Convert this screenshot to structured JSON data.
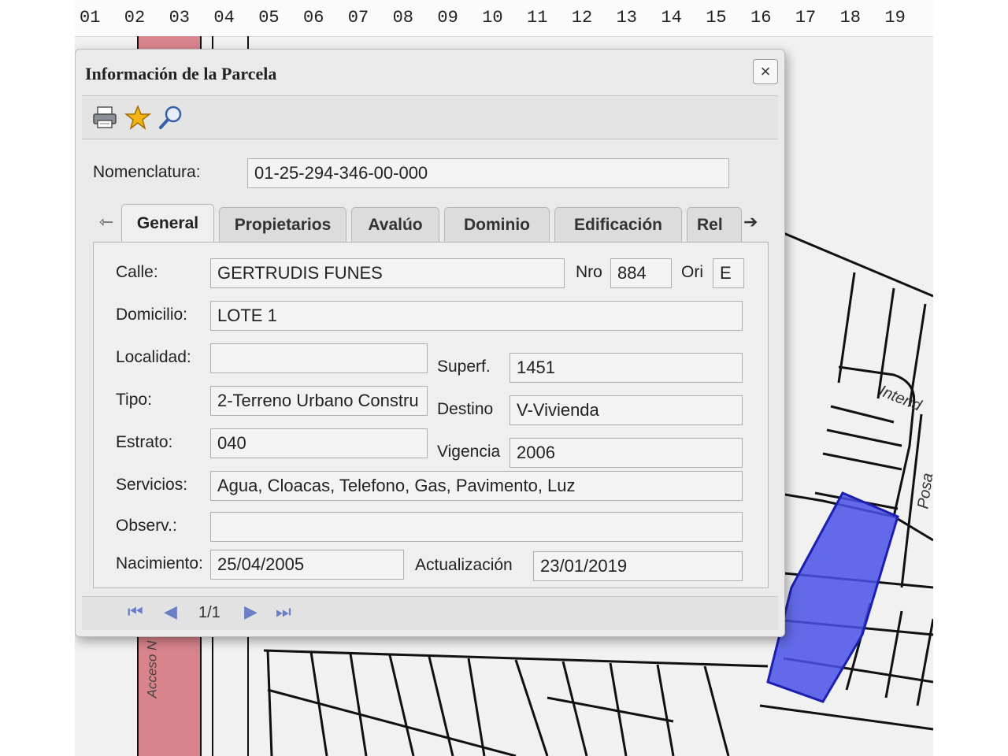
{
  "ruler": {
    "numbers": [
      "01",
      "02",
      "03",
      "04",
      "05",
      "06",
      "07",
      "08",
      "09",
      "10",
      "11",
      "12",
      "13",
      "14",
      "15",
      "16",
      "17",
      "18",
      "19"
    ]
  },
  "map": {
    "street_labels": {
      "intendente": "Intend",
      "posadas": "Posa",
      "acceso": "Acceso N"
    }
  },
  "dialog": {
    "title": "Información de la Parcela",
    "close_icon": "×",
    "toolbar": {
      "icons": [
        "print-icon",
        "star-icon",
        "search-icon"
      ]
    },
    "nomenclatura_label": "Nomenclatura:",
    "nomenclatura_value": "01-25-294-346-00-000",
    "tabs": {
      "prev_arrow": "⇽",
      "next_arrow": "➔",
      "items": [
        "General",
        "Propietarios",
        "Avalúo",
        "Dominio",
        "Edificación",
        "Rel"
      ],
      "active": "General"
    },
    "general": {
      "calle": {
        "label": "Calle:",
        "value": "GERTRUDIS FUNES"
      },
      "nro": {
        "label": "Nro",
        "value": "884"
      },
      "ori": {
        "label": "Ori",
        "value": "E"
      },
      "domicilio": {
        "label": "Domicilio:",
        "value": "LOTE 1"
      },
      "localidad": {
        "label": "Localidad:",
        "value": ""
      },
      "superf": {
        "label": "Superf.",
        "value": "1451"
      },
      "tipo": {
        "label": "Tipo:",
        "value": "2-Terreno Urbano Constru"
      },
      "destino": {
        "label": "Destino",
        "value": "V-Vivienda"
      },
      "estrato": {
        "label": "Estrato:",
        "value": "040"
      },
      "vigencia": {
        "label": "Vigencia",
        "value": "2006"
      },
      "servicios": {
        "label": "Servicios:",
        "value": "Agua, Cloacas, Telefono, Gas, Pavimento, Luz"
      },
      "observ": {
        "label": "Observ.:",
        "value": ""
      },
      "nacimiento": {
        "label": "Nacimiento:",
        "value": "25/04/2005"
      },
      "actualizacion": {
        "label": "Actualización",
        "value": "23/01/2019"
      }
    },
    "pager": {
      "text": "1/1"
    }
  },
  "colors": {
    "highlight_parcel": "#4a52e8",
    "street_red": "#d9848c"
  }
}
